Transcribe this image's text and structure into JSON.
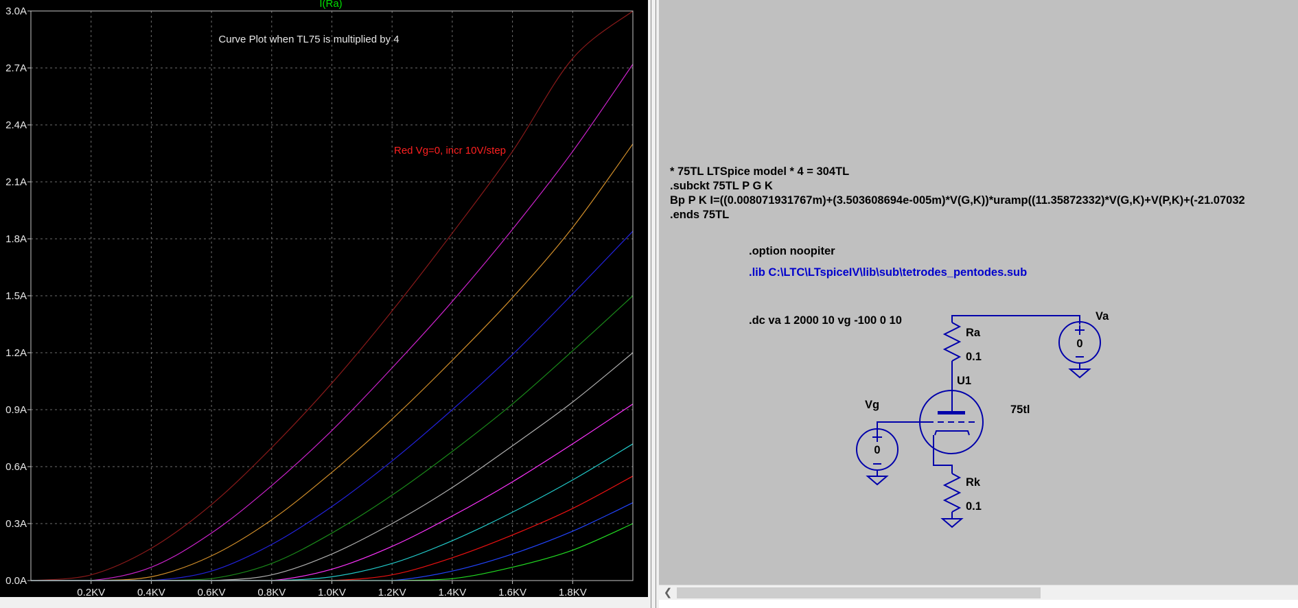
{
  "plot": {
    "trace_label": "I(Ra)",
    "title": "Curve Plot when TL75 is multiplied by 4",
    "annotation": "Red Vg=0, incr 10V/step",
    "y_tick_labels": [
      "0.0A",
      "0.3A",
      "0.6A",
      "0.9A",
      "1.2A",
      "1.5A",
      "1.8A",
      "2.1A",
      "2.4A",
      "2.7A",
      "3.0A"
    ],
    "x_tick_labels": [
      "0.2KV",
      "0.4KV",
      "0.6KV",
      "0.8KV",
      "1.0KV",
      "1.2KV",
      "1.4KV",
      "1.6KV",
      "1.8KV"
    ],
    "colors": {
      "background": "#000000",
      "frame": "#c8c8c8",
      "grid": "#6e6e6e",
      "text": "#e8e8e8",
      "trace_label": "#00e000",
      "annotation": "#ff2020"
    }
  },
  "chart_data": {
    "type": "line",
    "title": "Curve Plot when TL75 is multiplied by 4",
    "xlabel": "",
    "ylabel": "I(Ra)",
    "x_unit": "KV",
    "y_unit": "A",
    "xlim": [
      0,
      2.0
    ],
    "ylim": [
      0,
      3.0
    ],
    "grid": true,
    "x": [
      0,
      0.2,
      0.4,
      0.6,
      0.8,
      1.0,
      1.2,
      1.4,
      1.6,
      1.8,
      2.0
    ],
    "series": [
      {
        "color": "#8b1a1a",
        "values": [
          0,
          0.03,
          0.17,
          0.4,
          0.7,
          1.04,
          1.42,
          1.83,
          2.26,
          2.75,
          3.0
        ]
      },
      {
        "color": "#cc22cc",
        "values": [
          0,
          0,
          0.07,
          0.25,
          0.5,
          0.79,
          1.12,
          1.47,
          1.85,
          2.26,
          2.72
        ]
      },
      {
        "color": "#d4902a",
        "values": [
          0,
          0,
          0.02,
          0.13,
          0.32,
          0.57,
          0.85,
          1.16,
          1.49,
          1.86,
          2.3
        ]
      },
      {
        "color": "#2222dd",
        "values": [
          0,
          0,
          0,
          0.05,
          0.19,
          0.39,
          0.63,
          0.9,
          1.19,
          1.51,
          1.84
        ]
      },
      {
        "color": "#1a8a1a",
        "values": [
          0,
          0,
          0,
          0.01,
          0.09,
          0.25,
          0.45,
          0.68,
          0.93,
          1.21,
          1.5
        ]
      },
      {
        "color": "#b0b0b0",
        "values": [
          0,
          0,
          0,
          0,
          0.03,
          0.14,
          0.3,
          0.49,
          0.71,
          0.94,
          1.2
        ]
      },
      {
        "color": "#ff33ff",
        "values": [
          0,
          0,
          0,
          0,
          0,
          0.06,
          0.18,
          0.34,
          0.52,
          0.72,
          0.93
        ]
      },
      {
        "color": "#22cccc",
        "values": [
          0,
          0,
          0,
          0,
          0,
          0.02,
          0.09,
          0.21,
          0.36,
          0.53,
          0.72
        ]
      },
      {
        "color": "#ee1111",
        "values": [
          0,
          0,
          0,
          0,
          0,
          0,
          0.03,
          0.12,
          0.24,
          0.38,
          0.55
        ]
      },
      {
        "color": "#2244ff",
        "values": [
          0,
          0,
          0,
          0,
          0,
          0,
          0,
          0.05,
          0.14,
          0.26,
          0.41
        ]
      },
      {
        "color": "#22dd22",
        "values": [
          0,
          0,
          0,
          0,
          0,
          0,
          0,
          0.01,
          0.07,
          0.16,
          0.3
        ]
      }
    ]
  },
  "schematic": {
    "model_lines": [
      "* 75TL LTSpice model * 4 = 304TL",
      ".subckt 75TL P G K",
      "Bp P K I=((0.008071931767m)+(3.503608694e-005m)*V(G,K))*uramp((11.35872332)*V(G,K)+V(P,K)+(-21.07032",
      ".ends 75TL"
    ],
    "option": ".option noopiter",
    "lib": ".lib C:\\LTC\\LTspiceIV\\lib\\sub\\tetrodes_pentodes.sub",
    "dc": ".dc va 1 2000 10 vg -100 0 10",
    "labels": {
      "ra": "Ra",
      "ra_value": "0.1",
      "rk": "Rk",
      "rk_value": "0.1",
      "u1": "U1",
      "u1_model": "75tl",
      "va": "Va",
      "va_value": "0",
      "vg": "Vg",
      "vg_value": "0"
    },
    "colors": {
      "background": "#c0c0c0",
      "wire": "#0000aa",
      "lib_text": "#0000cc"
    }
  }
}
